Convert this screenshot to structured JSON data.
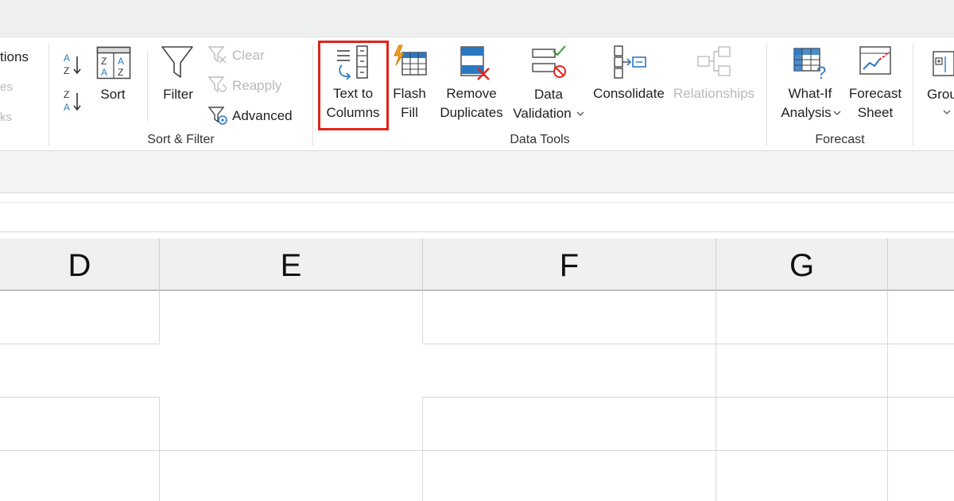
{
  "ribbon": {
    "clipped_left": [
      "tions",
      "es",
      "ks"
    ],
    "sort_filter": {
      "sort_az_label": "",
      "sort_label": "Sort",
      "filter_label": "Filter",
      "clear_label": "Clear",
      "reapply_label": "Reapply",
      "advanced_label": "Advanced",
      "group_label": "Sort & Filter"
    },
    "data_tools": {
      "text_to_columns_line1": "Text to",
      "text_to_columns_line2": "Columns",
      "flash_fill_line1": "Flash",
      "flash_fill_line2": "Fill",
      "remove_duplicates_line1": "Remove",
      "remove_duplicates_line2": "Duplicates",
      "data_validation_line1": "Data",
      "data_validation_line2": "Validation",
      "consolidate_label": "Consolidate",
      "relationships_label": "Relationships",
      "group_label": "Data Tools"
    },
    "forecast": {
      "what_if_line1": "What-If",
      "what_if_line2": "Analysis",
      "forecast_sheet_line1": "Forecast",
      "forecast_sheet_line2": "Sheet",
      "group_label": "Forecast"
    },
    "outline": {
      "group_label_clipped": "Grou"
    }
  },
  "sheet": {
    "columns": [
      "D",
      "E",
      "F",
      "G"
    ]
  },
  "colors": {
    "highlight": "#e2231a",
    "accent_blue": "#2b78c2",
    "accent_red": "#e2231a",
    "accent_orange": "#f0a020",
    "ribbon_bg": "#ffffff",
    "header_bg": "#f0f0f0"
  },
  "icons": {
    "sort_az": "sort-a-to-z-icon",
    "sort_za": "sort-z-to-a-icon",
    "sort": "sort-dialog-icon",
    "filter": "funnel-icon",
    "clear": "clear-filter-icon",
    "reapply": "reapply-filter-icon",
    "advanced": "advanced-filter-icon",
    "text_to_columns": "text-to-columns-icon",
    "flash_fill": "flash-fill-icon",
    "remove_duplicates": "remove-duplicates-icon",
    "data_validation": "data-validation-icon",
    "consolidate": "consolidate-icon",
    "relationships": "relationships-icon",
    "what_if": "what-if-icon",
    "forecast_sheet": "forecast-sheet-icon",
    "group": "group-icon"
  }
}
